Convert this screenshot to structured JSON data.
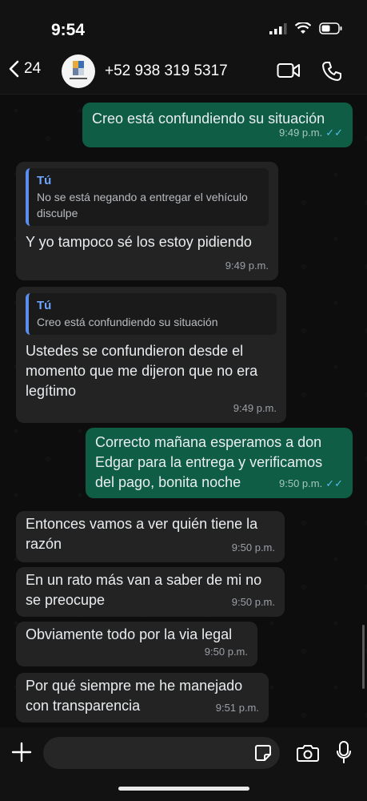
{
  "status": {
    "time": "9:54"
  },
  "header": {
    "back_count": "24",
    "contact": "+52 938 319 5317",
    "icons": [
      "chevron-left-icon",
      "video-call-icon",
      "phone-icon"
    ]
  },
  "messages": [
    {
      "dir": "out",
      "text": "Creo está confundiendo su situación",
      "time": "9:49 p.m.",
      "read": true
    },
    {
      "dir": "in",
      "quote_author": "Tú",
      "quote_text": "No se está negando a entregar el vehículo disculpe",
      "text": "Y yo tampoco sé los estoy pidiendo",
      "time": "9:49 p.m."
    },
    {
      "dir": "in",
      "quote_author": "Tú",
      "quote_text": "Creo está confundiendo su situación",
      "text": "Ustedes se confundieron desde el momento que me dijeron que no era legítimo",
      "time": "9:49 p.m."
    },
    {
      "dir": "out",
      "text": "Correcto mañana esperamos a don Edgar para la entrega y verificamos del pago, bonita noche",
      "time": "9:50 p.m.",
      "read": true
    },
    {
      "dir": "in",
      "text": "Entonces vamos a ver quién tiene la razón",
      "time": "9:50 p.m."
    },
    {
      "dir": "in",
      "text": "En un rato más van a saber de mi no se preocupe",
      "time": "9:50 p.m."
    },
    {
      "dir": "in",
      "text": "Obviamente todo por la via legal",
      "time": "9:50 p.m."
    },
    {
      "dir": "in",
      "text": "Por qué siempre me he manejado con transparencia",
      "time": "9:51 p.m."
    }
  ],
  "composer": {
    "icons": [
      "plus-icon",
      "sticker-icon",
      "camera-icon",
      "microphone-icon"
    ]
  },
  "colors": {
    "outgoing": "#0f5d44",
    "incoming": "#232323",
    "read_tick": "#53bdeb",
    "quote_bar": "#5b8def"
  }
}
